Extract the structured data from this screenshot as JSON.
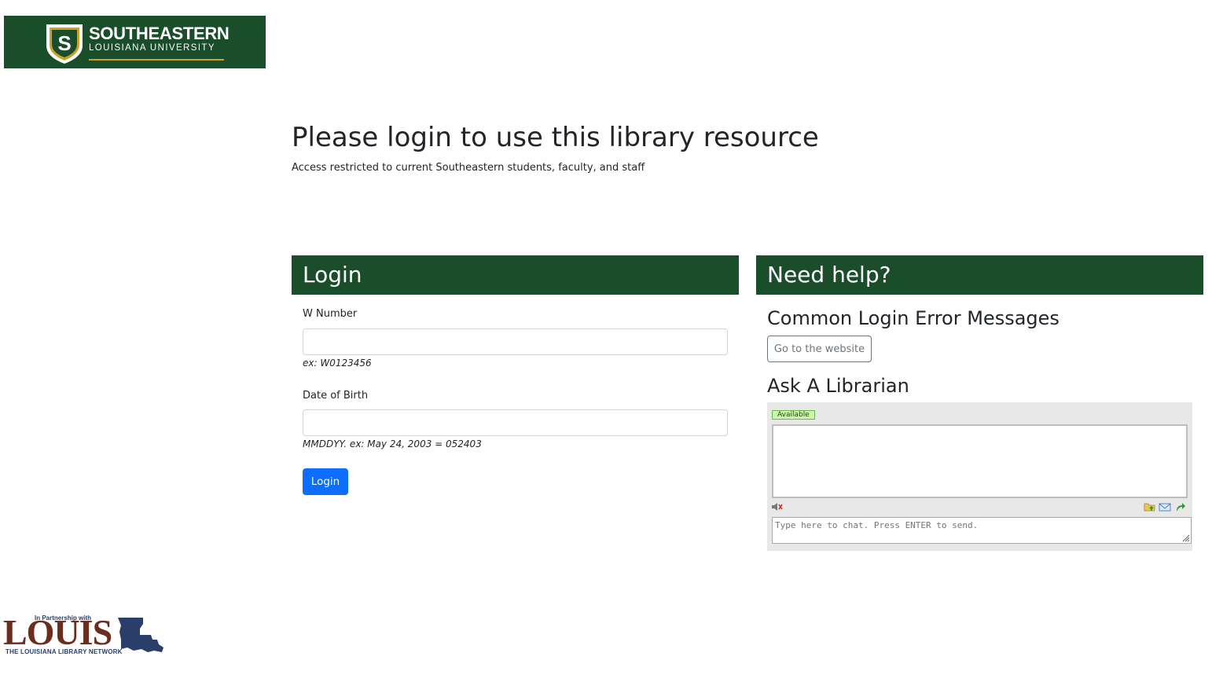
{
  "brand": {
    "shield_letter": "S",
    "name": "SOUTHEASTERN",
    "subname": "LOUISIANA UNIVERSITY"
  },
  "page": {
    "title": "Please login to use this library resource",
    "subtitle": "Access restricted to current Southeastern students, faculty, and staff"
  },
  "login": {
    "header": "Login",
    "w_number_label": "W Number",
    "w_number_value": "",
    "w_number_hint": "ex: W0123456",
    "dob_label": "Date of Birth",
    "dob_value": "",
    "dob_hint": "MMDDYY. ex: May 24, 2003 = 052403",
    "submit_label": "Login"
  },
  "help": {
    "header": "Need help?",
    "errors_heading": "Common Login Error Messages",
    "website_button": "Go to the website",
    "librarian_heading": "Ask A Librarian"
  },
  "chat": {
    "status": "Available",
    "input_placeholder": "Type here to chat. Press ENTER to send.",
    "icons": [
      "speaker-icon",
      "folder-upload-icon",
      "email-icon",
      "pop-out-icon"
    ]
  },
  "footer": {
    "partner_text": "In Partnership with",
    "logo_word": "LOUIS",
    "network_text": "THE LOUISIANA LIBRARY NETWORK"
  },
  "colors": {
    "brand_green": "#1a4d2a",
    "brand_gold": "#c9a227",
    "primary_blue": "#0d6efd",
    "louis_brown": "#6b2e1c",
    "louis_blue": "#2a3e6a"
  }
}
